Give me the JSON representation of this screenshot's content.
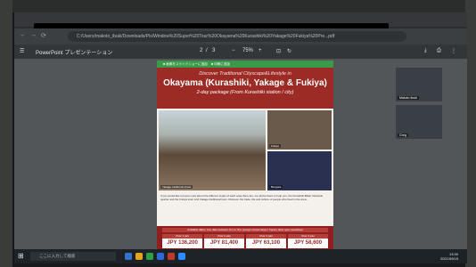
{
  "browser": {
    "url": "C:/Users/makoto_ibuki/Downloads/Pls/Window%20Super%20Tour%20Okayama%20Kurashiki%20Yakage%20Fukiya%20Pre...pdf",
    "nav_back": "←",
    "nav_forward": "→",
    "nav_reload": "⟳"
  },
  "viewer": {
    "app_title": "PowerPoint プレゼンテーション",
    "page_current": "2",
    "page_sep": "/",
    "page_total": "3",
    "zoom": "75%",
    "minus": "−",
    "plus": "+"
  },
  "document": {
    "green_buttons": [
      "■ 画像をスライドショーに追加",
      "■ 印刷に追加"
    ],
    "banner": {
      "line1": "Discover Traditional Cityscape&Lifestyle in",
      "line2": "Okayama (Kurashiki, Yakage & Fukiya)",
      "line3": "2-day package (From Kurashiki station / city)"
    },
    "photo_caption_main": "Yakage traditional street",
    "photo_caption_a": "Fukiya",
    "photo_caption_b": "Bengara",
    "description": "If you would like to know more about the different styles of each area there are: we will be there to help you, the Kurashiki Bikan historical quarter and the Fukiya town and Yakage traditional town. Discover the trade, life and culture of people who lived in the area...",
    "price_header": "Available dates: Any date between Jun to Nov (except closed days) / Inquiry desk open weekdays",
    "prices": [
      {
        "label": "Over 1 pax",
        "value": "JPY 136,200"
      },
      {
        "label": "Over 2 pax",
        "value": "JPY 81,400"
      },
      {
        "label": "Over 3 pax",
        "value": "JPY 63,100"
      },
      {
        "label": "Over 4 pax",
        "value": "JPY 58,600"
      }
    ]
  },
  "participants": [
    {
      "name": "Makoto Ibuki"
    },
    {
      "name": "Greg"
    }
  ],
  "taskbar": {
    "search_placeholder": "ここに入力して検索",
    "time": "13:30",
    "date": "2021/09/15"
  }
}
